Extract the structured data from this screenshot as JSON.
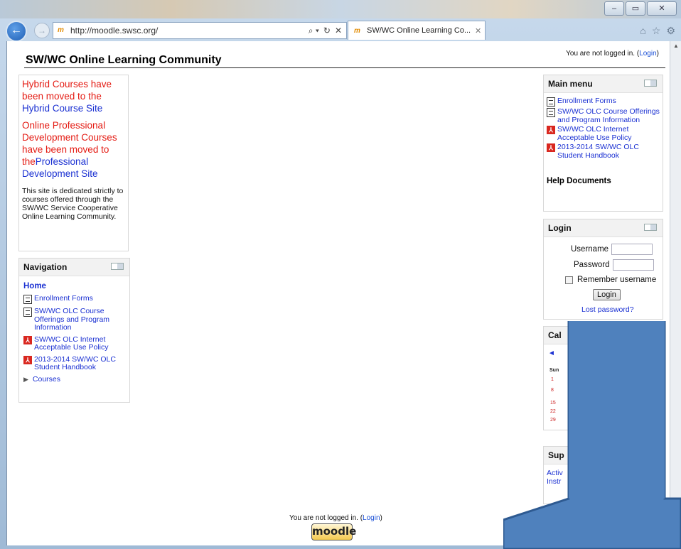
{
  "browser": {
    "url": "http://moodle.swsc.org/",
    "tab_title": "SW/WC Online Learning Co...",
    "window_buttons": [
      "–",
      "▭",
      "✕"
    ],
    "toolbar_icons": [
      "home-icon",
      "star-icon",
      "gear-icon"
    ],
    "address_tools": [
      "⌕ ▾",
      "↻",
      "✕"
    ]
  },
  "page": {
    "title": "SW/WC Online Learning Community",
    "login_prefix": "You are not logged in. (",
    "login_link": "Login",
    "login_suffix": ")"
  },
  "announcement": {
    "line1": "Hybrid Courses have been moved to the",
    "line1_link": "Hybrid Course Site",
    "line2": "Online Professional Development Courses have been moved to the",
    "line2_link": "Professional Development Site",
    "description": "This site is dedicated strictly to courses offered through the SW/WC Service Cooperative Online Learning Community."
  },
  "navigation": {
    "title": "Navigation",
    "home": "Home",
    "items": [
      {
        "label": "Enrollment Forms",
        "icon": "document-icon"
      },
      {
        "label": "SW/WC OLC Course Offerings and Program Information",
        "icon": "document-icon"
      },
      {
        "label": "SW/WC OLC Internet Acceptable Use Policy",
        "icon": "pdf-icon"
      },
      {
        "label": "2013-2014 SW/WC OLC Student Handbook",
        "icon": "pdf-icon"
      }
    ],
    "courses": "Courses"
  },
  "main_menu": {
    "title": "Main menu",
    "items": [
      {
        "label": "Enrollment Forms",
        "icon": "document-icon"
      },
      {
        "label": "SW/WC OLC Course Offerings and Program Information",
        "icon": "document-icon"
      },
      {
        "label": "SW/WC OLC Internet Acceptable Use Policy",
        "icon": "pdf-icon"
      },
      {
        "label": "2013-2014 SW/WC OLC Student Handbook",
        "icon": "pdf-icon"
      }
    ],
    "help": "Help Documents"
  },
  "login_block": {
    "title": "Login",
    "username_label": "Username",
    "password_label": "Password",
    "remember_label": "Remember username",
    "button": "Login",
    "lost_password": "Lost password?"
  },
  "calendar": {
    "title_partial": "Cal",
    "prev": "◄",
    "day_header": "Sun",
    "dates": [
      "1",
      "8",
      "15",
      "22",
      "29"
    ]
  },
  "support": {
    "title_partial": "Sup",
    "line1": "Activ",
    "line2": "Instr"
  },
  "footer": {
    "login_prefix": "You are not logged in. (",
    "login_link": "Login",
    "login_suffix": ")",
    "logo": "moodle"
  },
  "colors": {
    "announcement_red": "#e41b13",
    "link_blue": "#1a30d2",
    "arrow_blue": "#4f81bd"
  }
}
